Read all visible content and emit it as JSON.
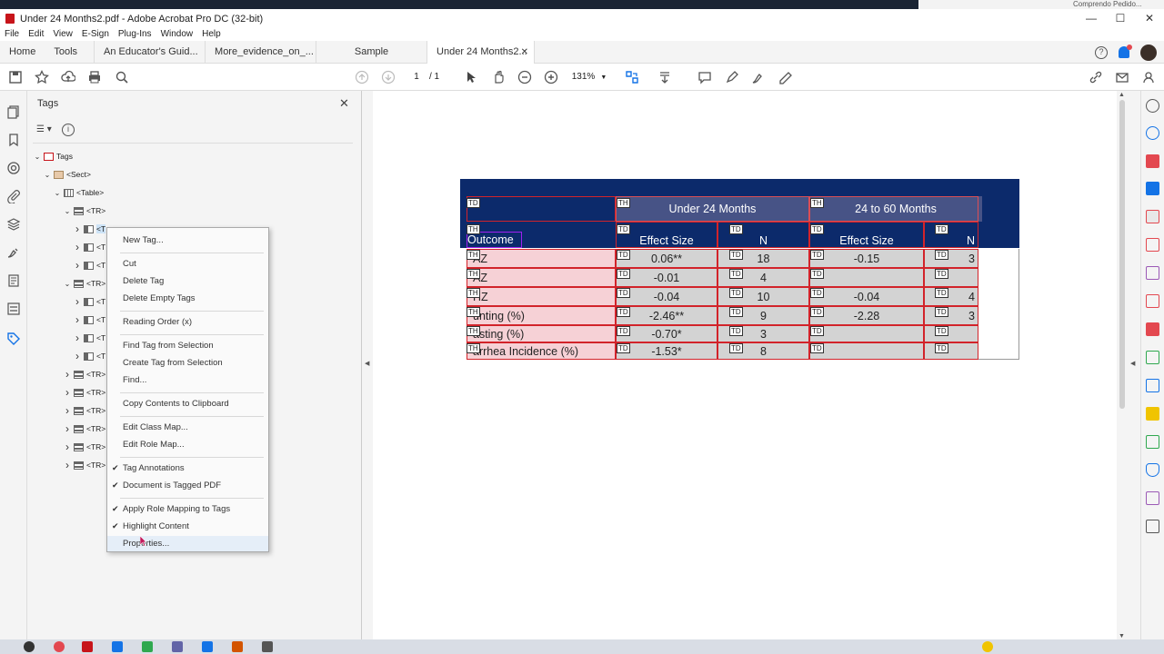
{
  "window": {
    "title": "Under 24 Months2.pdf - Adobe Acrobat Pro DC (32-bit)",
    "minimize": "—",
    "maximize": "☐",
    "close": "✕"
  },
  "menu": [
    "File",
    "Edit",
    "View",
    "E-Sign",
    "Plug-Ins",
    "Window",
    "Help"
  ],
  "tabs": {
    "home": "Home",
    "tools": "Tools",
    "docs": [
      "An Educator's Guid...",
      "More_evidence_on_...",
      "Sample",
      "Under 24 Months2..."
    ],
    "active_index": 3
  },
  "toolbar": {
    "page_current": "1",
    "page_total": "/ 1",
    "zoom": "131%"
  },
  "tags_panel": {
    "title": "Tags",
    "tree": [
      {
        "label": "Tags",
        "depth": 0,
        "expanded": true,
        "icon": "pdf"
      },
      {
        "label": "<Sect>",
        "depth": 1,
        "expanded": true,
        "icon": "sect"
      },
      {
        "label": "<Table>",
        "depth": 2,
        "expanded": true,
        "icon": "grid"
      },
      {
        "label": "<TR>",
        "depth": 3,
        "expanded": true,
        "icon": "row"
      },
      {
        "label": "<T",
        "depth": 4,
        "expanded": false,
        "icon": "cell",
        "selected": true
      },
      {
        "label": "<T",
        "depth": 4,
        "expanded": false,
        "icon": "cell"
      },
      {
        "label": "<T",
        "depth": 4,
        "expanded": false,
        "icon": "cell"
      },
      {
        "label": "<TR>",
        "depth": 3,
        "expanded": true,
        "icon": "row"
      },
      {
        "label": "<T",
        "depth": 4,
        "expanded": false,
        "icon": "cell"
      },
      {
        "label": "<T",
        "depth": 4,
        "expanded": false,
        "icon": "cell"
      },
      {
        "label": "<T",
        "depth": 4,
        "expanded": false,
        "icon": "cell"
      },
      {
        "label": "<T",
        "depth": 4,
        "expanded": false,
        "icon": "cell"
      },
      {
        "label": "<TR>",
        "depth": 3,
        "expanded": false,
        "icon": "row"
      },
      {
        "label": "<TR>",
        "depth": 3,
        "expanded": false,
        "icon": "row"
      },
      {
        "label": "<TR>",
        "depth": 3,
        "expanded": false,
        "icon": "row"
      },
      {
        "label": "<TR>",
        "depth": 3,
        "expanded": false,
        "icon": "row"
      },
      {
        "label": "<TR>",
        "depth": 3,
        "expanded": false,
        "icon": "row"
      },
      {
        "label": "<TR>",
        "depth": 3,
        "expanded": false,
        "icon": "row"
      }
    ]
  },
  "context_menu": {
    "items": [
      {
        "label": "New Tag...",
        "checked": false
      },
      {
        "sep": true
      },
      {
        "label": "Cut",
        "checked": false
      },
      {
        "label": "Delete Tag",
        "checked": false
      },
      {
        "label": "Delete Empty Tags",
        "checked": false
      },
      {
        "sep": true
      },
      {
        "label": "Reading Order (x)",
        "checked": false
      },
      {
        "sep": true
      },
      {
        "label": "Find Tag from Selection",
        "checked": false
      },
      {
        "label": "Create Tag from Selection",
        "checked": false
      },
      {
        "label": "Find...",
        "checked": false
      },
      {
        "sep": true
      },
      {
        "label": "Copy Contents to Clipboard",
        "checked": false
      },
      {
        "sep": true
      },
      {
        "label": "Edit Class Map...",
        "checked": false
      },
      {
        "label": "Edit Role Map...",
        "checked": false
      },
      {
        "sep": true
      },
      {
        "label": "Tag Annotations",
        "checked": true
      },
      {
        "label": "Document is Tagged PDF",
        "checked": true
      },
      {
        "sep": true
      },
      {
        "label": "Apply Role Mapping to Tags",
        "checked": true
      },
      {
        "label": "Highlight Content",
        "checked": true
      },
      {
        "label": "Properties...",
        "checked": false,
        "highlighted": true
      }
    ],
    "check_glyph": "✔"
  },
  "pdf_table": {
    "group_headers": [
      "Under 24 Months",
      "24 to 60 Months"
    ],
    "sub_headers": {
      "outcome": "Outcome",
      "effect": "Effect Size",
      "n": "N"
    },
    "rows": [
      {
        "outcome": "AZ",
        "es1": "0.06**",
        "n1": "18",
        "es2": "-0.15",
        "n2": "3"
      },
      {
        "outcome": "AZ",
        "es1": "-0.01",
        "n1": "4",
        "es2": "",
        "n2": ""
      },
      {
        "outcome": "HZ",
        "es1": "-0.04",
        "n1": "10",
        "es2": "-0.04",
        "n2": "4"
      },
      {
        "outcome": "unting (%)",
        "es1": "-2.46**",
        "n1": "9",
        "es2": "-2.28",
        "n2": "3"
      },
      {
        "outcome": "asting (%)",
        "es1": "-0.70*",
        "n1": "3",
        "es2": "",
        "n2": ""
      },
      {
        "outcome": "arrhea Incidence (%)",
        "es1": "-1.53*",
        "n1": "8",
        "es2": "",
        "n2": ""
      }
    ],
    "tag_th": "TH",
    "tag_td": "TD"
  },
  "topstrip_right": "Comprendo Pedido...",
  "colors": {
    "header_navy": "#0c2a6b",
    "th_pink": "#f6d1d6",
    "td_gray": "#d3d3d3",
    "tag_red": "#d2232a",
    "accent_blue": "#1473e6"
  }
}
